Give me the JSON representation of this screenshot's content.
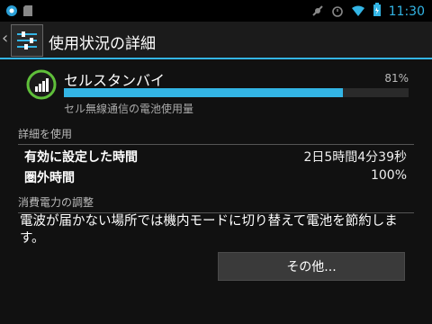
{
  "statusbar": {
    "time": "11:30",
    "icons": [
      "app-notification-icon",
      "sd-card-icon",
      "no-sound-icon",
      "alarm-icon",
      "wifi-icon",
      "battery-charging-icon"
    ]
  },
  "actionbar": {
    "title": "使用状況の詳細",
    "icon": "settings-icon"
  },
  "detail": {
    "name": "セルスタンバイ",
    "percent_label": "81%",
    "percent_value": 0.81,
    "subtitle": "セル無線通信の電池使用量",
    "icon": "cell-signal-icon"
  },
  "usage_section": {
    "header": "詳細を使用",
    "rows": [
      {
        "label": "有効に設定した時間",
        "value": "2日5時間4分39秒"
      },
      {
        "label": "圏外時間",
        "value": "100%"
      }
    ]
  },
  "power_section": {
    "header": "消費電力の調整",
    "description": "電波が届かない場所では機内モードに切り替えて電池を節約します。"
  },
  "more_button": {
    "label": "その他..."
  },
  "colors": {
    "accent": "#33b5e5",
    "background": "#111111"
  }
}
